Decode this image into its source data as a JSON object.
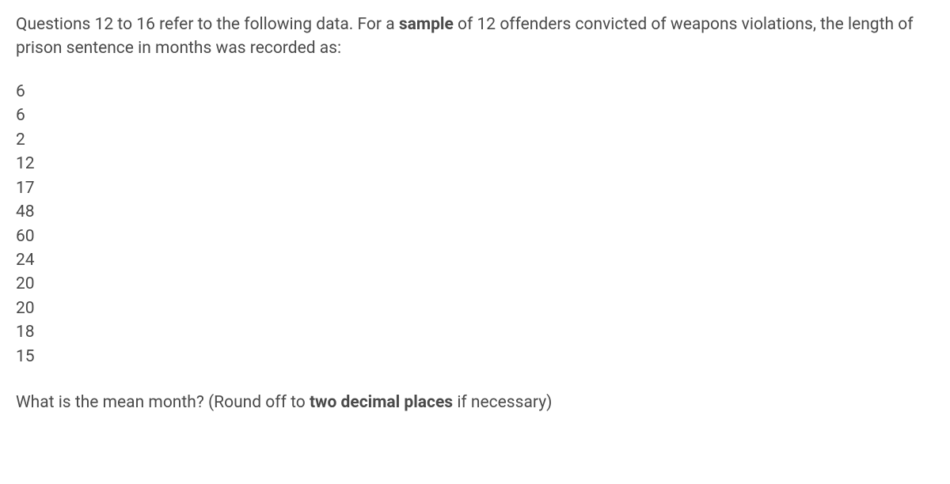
{
  "intro": {
    "part1": "Questions 12 to 16 refer to the following data. For a ",
    "bold1": "sample",
    "part2": " of 12 offenders convicted of weapons violations, the length of prison sentence in months was recorded as:"
  },
  "data_values": [
    "6",
    "6",
    "2",
    "12",
    "17",
    "48",
    "60",
    "24",
    "20",
    "20",
    "18",
    "15"
  ],
  "question": {
    "part1": "What is the mean month? (Round off to ",
    "bold1": "two decimal places",
    "part2": " if necessary)"
  }
}
